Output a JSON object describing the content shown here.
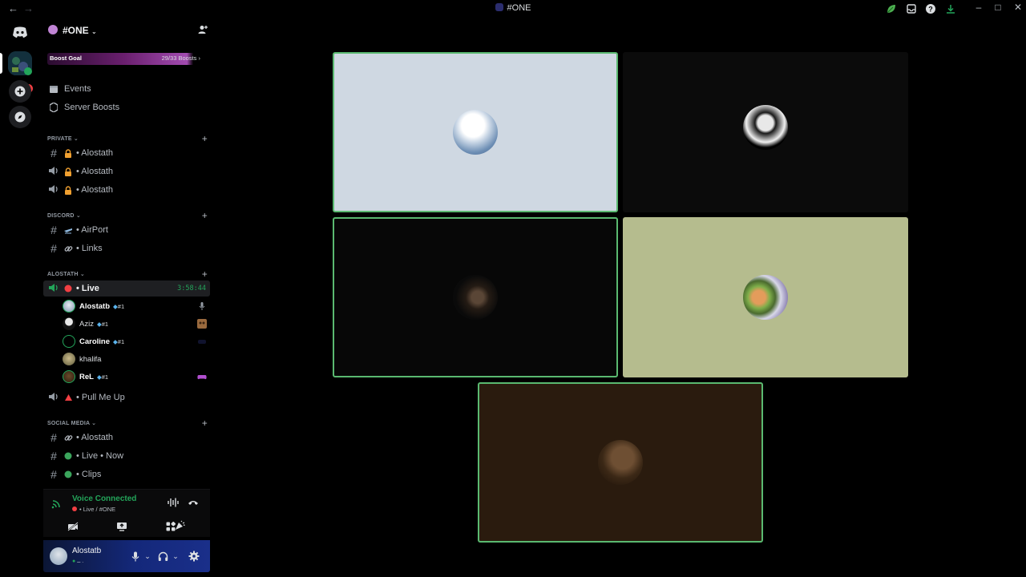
{
  "window": {
    "title": "#ONE",
    "colors": {
      "background": "#000000",
      "speaking": "#5ab970",
      "online": "#23a55a",
      "live": "#f23f43"
    }
  },
  "rail": {
    "mention_count": "1"
  },
  "server": {
    "name": "#ONE",
    "boost": {
      "label": "Boost Goal",
      "count": "29/33 Boosts",
      "progress": 0.88
    },
    "menu": [
      {
        "label": "Events",
        "icon": "calendar-icon"
      },
      {
        "label": "Server Boosts",
        "icon": "boost-gem-icon"
      }
    ]
  },
  "categories": {
    "private": "PRIVATE",
    "discord": "DISCORD",
    "alostath": "ALOSTATH",
    "social": "SOCIAL MEDIA"
  },
  "channels": {
    "private": [
      {
        "name": "• Alostath",
        "icon": "hash-icon"
      },
      {
        "name": "• Alostath",
        "icon": "speaker-icon"
      },
      {
        "name": "• Alostath",
        "icon": "speaker-icon"
      }
    ],
    "discord": [
      {
        "name": "• AirPort",
        "icon": "hash-icon"
      },
      {
        "name": "• Links",
        "icon": "hash-icon"
      }
    ],
    "live": {
      "name": "• Live",
      "timer": "3:58:44"
    },
    "pull": {
      "name": "• Pull Me Up"
    },
    "social": [
      {
        "name": "• Alostath"
      },
      {
        "name": "• Live • Now"
      },
      {
        "name": "• Clips"
      }
    ]
  },
  "voice_members": [
    {
      "name": "Alostatb",
      "tag": "#1",
      "has_tag": true
    },
    {
      "name": "Aziz",
      "tag": "#1",
      "has_tag": true
    },
    {
      "name": "Caroline",
      "tag": "#1",
      "has_tag": true
    },
    {
      "name": "khalifa",
      "tag": "",
      "has_tag": false
    },
    {
      "name": "ReL",
      "tag": "#1",
      "has_tag": true
    }
  ],
  "voice_panel": {
    "status": "Voice Connected",
    "channel": "• Live / #ONE"
  },
  "user": {
    "name": "Alostatb",
    "sub": "ــ ."
  },
  "stage": {
    "tiles": [
      {
        "bg": "#cfd8e2",
        "speaking": true,
        "avatar": "sky"
      },
      {
        "bg": "#0b0b0b",
        "speaking": false,
        "avatar": "dark"
      },
      {
        "bg": "#070707",
        "speaking": true,
        "avatar": "shadow"
      },
      {
        "bg": "#b5bc8e",
        "speaking": false,
        "avatar": "cartoon"
      },
      {
        "bg": "#2a1b0e",
        "speaking": true,
        "avatar": "brown"
      }
    ]
  }
}
